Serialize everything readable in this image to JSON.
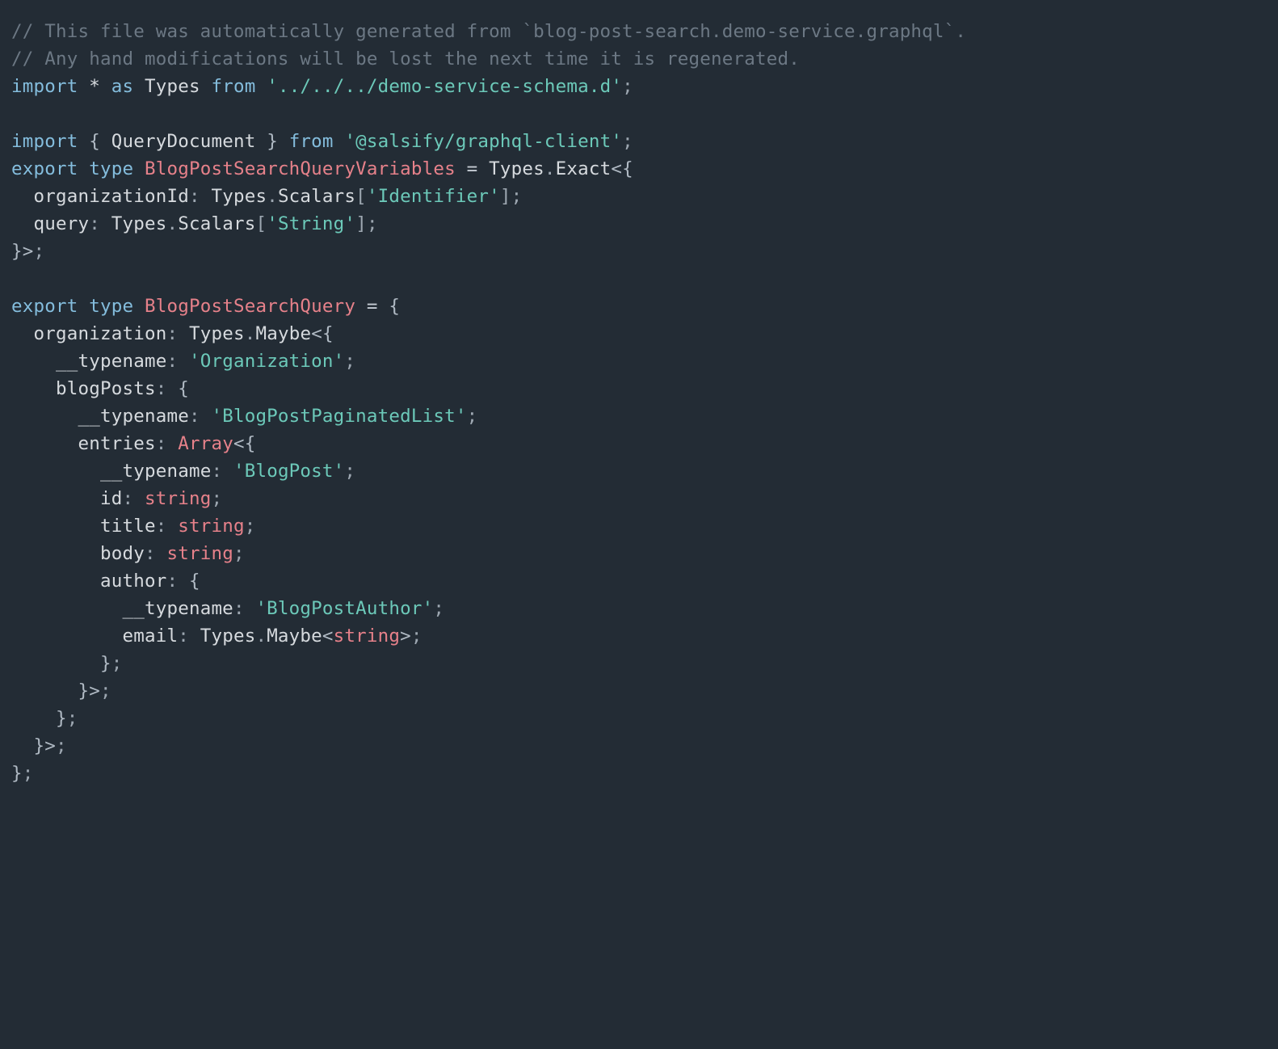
{
  "comments": {
    "l1": "// This file was automatically generated from `blog-post-search.demo-service.graphql`.",
    "l2": "// Any hand modifications will be lost the next time it is regenerated."
  },
  "kw": {
    "import": "import",
    "export": "export",
    "type": "type",
    "as": "as",
    "from": "from",
    "star": "*"
  },
  "idents": {
    "Types": "Types",
    "QueryDocument": "QueryDocument",
    "Exact": "Exact",
    "Scalars": "Scalars",
    "Maybe": "Maybe",
    "organizationId": "organizationId",
    "query": "query",
    "organization": "organization",
    "__typename": "__typename",
    "blogPosts": "blogPosts",
    "entries": "entries",
    "id": "id",
    "title": "title",
    "body": "body",
    "author": "author",
    "email": "email"
  },
  "types": {
    "BlogPostSearchQueryVariables": "BlogPostSearchQueryVariables",
    "BlogPostSearchQuery": "BlogPostSearchQuery",
    "Array": "Array",
    "string": "string"
  },
  "strings": {
    "schemaPath": "'../../../demo-service-schema.d'",
    "clientPath": "'@salsify/graphql-client'",
    "Identifier": "'Identifier'",
    "String": "'String'",
    "Organization": "'Organization'",
    "BlogPostPaginatedList": "'BlogPostPaginatedList'",
    "BlogPost": "'BlogPost'",
    "BlogPostAuthor": "'BlogPostAuthor'"
  },
  "punct": {
    "colon": ":",
    "semi": ";",
    "dot": ".",
    "comma": ",",
    "lbracket": "[",
    "rbracket": "]",
    "lbrace": "{",
    "rbrace": "}",
    "lt": "<",
    "gt": ">",
    "eq": "="
  }
}
